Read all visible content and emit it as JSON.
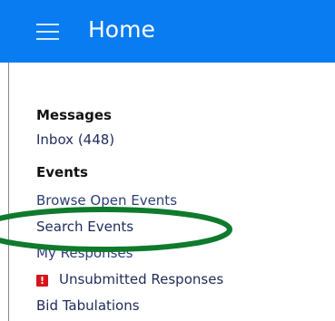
{
  "header": {
    "title": "Home",
    "menu_icon": "hamburger-menu-icon",
    "background": "#0a7cf1"
  },
  "messages": {
    "heading": "Messages",
    "inbox_label": "Inbox (448)"
  },
  "events": {
    "heading": "Events",
    "items": [
      {
        "label": "Browse Open Events"
      },
      {
        "label": "Search Events"
      },
      {
        "label": "My Responses"
      },
      {
        "label": "Unsubmitted Responses",
        "icon": "alert-icon"
      },
      {
        "label": "Bid Tabulations"
      }
    ]
  },
  "annotation": {
    "color": "#0f7a2c",
    "shape": "ellipse"
  }
}
